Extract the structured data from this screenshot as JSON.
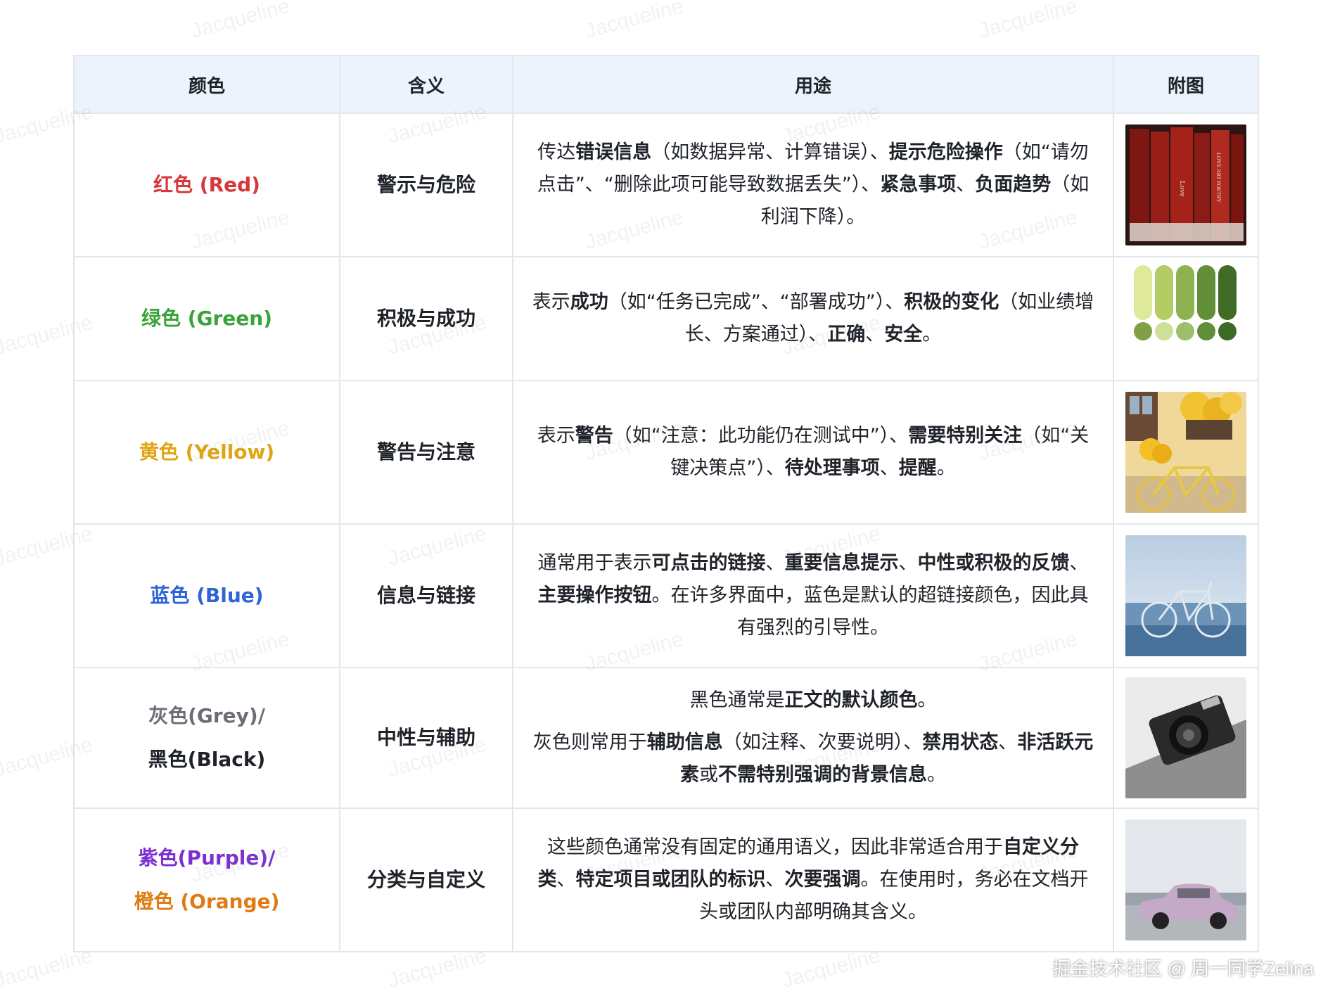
{
  "headers": [
    "颜色",
    "含义",
    "用途",
    "附图"
  ],
  "rows": [
    {
      "color_lines": [
        "红色 (Red)"
      ],
      "color_hex": "#d8373a",
      "meaning": "警示与危险",
      "usage_paragraphs": [
        [
          {
            "t": "传达",
            "b": false
          },
          {
            "t": "错误信息",
            "b": true
          },
          {
            "t": "（如数据异常、计算错误）、",
            "b": false
          },
          {
            "t": "提示危险操作",
            "b": true
          },
          {
            "t": "（如“请勿点击”、“删除此项可能导致数据丢失”）、",
            "b": false
          },
          {
            "t": "紧急事项",
            "b": true
          },
          {
            "t": "、",
            "b": false
          },
          {
            "t": "负面趋势",
            "b": true
          },
          {
            "t": "（如利润下降）。",
            "b": false
          }
        ]
      ],
      "image_icon": "red-books-image"
    },
    {
      "color_lines": [
        "绿色 (Green)"
      ],
      "color_hex": "#3aa338",
      "meaning": "积极与成功",
      "usage_paragraphs": [
        [
          {
            "t": "表示",
            "b": false
          },
          {
            "t": "成功",
            "b": true
          },
          {
            "t": "（如“任务已完成”、“部署成功”）、",
            "b": false
          },
          {
            "t": "积极的变化",
            "b": true
          },
          {
            "t": "（如业绩增长、方案通过）、",
            "b": false
          },
          {
            "t": "正确",
            "b": true
          },
          {
            "t": "、",
            "b": false
          },
          {
            "t": "安全",
            "b": true
          },
          {
            "t": "。",
            "b": false
          }
        ]
      ],
      "image_icon": "green-palette-image"
    },
    {
      "color_lines": [
        "黄色 (Yellow)"
      ],
      "color_hex": "#e0a512",
      "meaning": "警告与注意",
      "usage_paragraphs": [
        [
          {
            "t": "表示",
            "b": false
          },
          {
            "t": "警告",
            "b": true
          },
          {
            "t": "（如“注意：此功能仍在测试中”）、",
            "b": false
          },
          {
            "t": "需要特别关注",
            "b": true
          },
          {
            "t": "（如“关键决策点”）、",
            "b": false
          },
          {
            "t": "待处理事项",
            "b": true
          },
          {
            "t": "、",
            "b": false
          },
          {
            "t": "提醒",
            "b": true
          },
          {
            "t": "。",
            "b": false
          }
        ]
      ],
      "image_icon": "yellow-bicycle-flowers-image"
    },
    {
      "color_lines": [
        "蓝色 (Blue)"
      ],
      "color_hex": "#2f64d6",
      "meaning": "信息与链接",
      "usage_paragraphs": [
        [
          {
            "t": "通常用于表示",
            "b": false
          },
          {
            "t": "可点击的链接",
            "b": true
          },
          {
            "t": "、",
            "b": false
          },
          {
            "t": "重要信息提示",
            "b": true
          },
          {
            "t": "、",
            "b": false
          },
          {
            "t": "中性或积极的反馈",
            "b": true
          },
          {
            "t": "、",
            "b": false
          },
          {
            "t": "主要操作按钮",
            "b": true
          },
          {
            "t": "。在许多界面中，蓝色是默认的超链接颜色，因此具有强烈的引导性。",
            "b": false
          }
        ]
      ],
      "image_icon": "blue-bicycle-beach-image"
    },
    {
      "color_lines": [
        "灰色(Grey)/",
        "黑色(Black)"
      ],
      "color_hex_lines": [
        "#6b6f75",
        "#1f2329"
      ],
      "meaning": "中性与辅助",
      "usage_paragraphs": [
        [
          {
            "t": "黑色通常是",
            "b": false
          },
          {
            "t": "正文的默认颜色",
            "b": true
          },
          {
            "t": "。",
            "b": false
          }
        ],
        [
          {
            "t": "灰色则常用于",
            "b": false
          },
          {
            "t": "辅助信息",
            "b": true
          },
          {
            "t": "（如注释、次要说明）、",
            "b": false
          },
          {
            "t": "禁用状态",
            "b": true
          },
          {
            "t": "、",
            "b": false
          },
          {
            "t": "非活跃元素",
            "b": true
          },
          {
            "t": "或",
            "b": false
          },
          {
            "t": "不需特别强调的背景信息",
            "b": true
          },
          {
            "t": "。",
            "b": false
          }
        ]
      ],
      "image_icon": "grey-camera-image"
    },
    {
      "color_lines": [
        "紫色(Purple)/",
        "橙色 (Orange)"
      ],
      "color_hex_lines": [
        "#7d2fd1",
        "#e07b12"
      ],
      "meaning": "分类与自定义",
      "usage_paragraphs": [
        [
          {
            "t": "这些颜色通常没有固定的通用语义，因此非常适合用于",
            "b": false
          },
          {
            "t": "自定义分类",
            "b": true
          },
          {
            "t": "、",
            "b": false
          },
          {
            "t": "特定项目或团队的标识",
            "b": true
          },
          {
            "t": "、",
            "b": false
          },
          {
            "t": "次要强调",
            "b": true
          },
          {
            "t": "。在使用时，务必在文档开头或团队内部明确其含义。",
            "b": false
          }
        ]
      ],
      "image_icon": "purple-car-image"
    }
  ],
  "watermark": "Jacqueline",
  "footer": "掘金技术社区 @ 周一同学Zelina"
}
